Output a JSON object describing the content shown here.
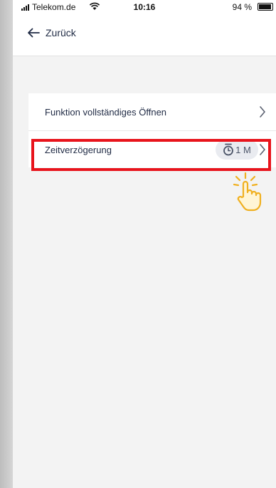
{
  "status_bar": {
    "carrier": "Telekom.de",
    "time": "10:16",
    "battery": "94 %"
  },
  "header": {
    "back_label": "Zurück"
  },
  "list": {
    "items": [
      {
        "label": "Funktion vollständiges Öffnen"
      },
      {
        "label": "Zeitverzögerung",
        "badge": "1 M"
      }
    ]
  },
  "colors": {
    "highlight": "#e8141c",
    "accent_hand": "#f0b020",
    "text": "#1f2a44"
  },
  "icons": [
    "signal-icon",
    "wifi-icon",
    "battery-icon",
    "back-arrow-icon",
    "chevron-right-icon",
    "timer-icon",
    "tap-hand-icon"
  ]
}
